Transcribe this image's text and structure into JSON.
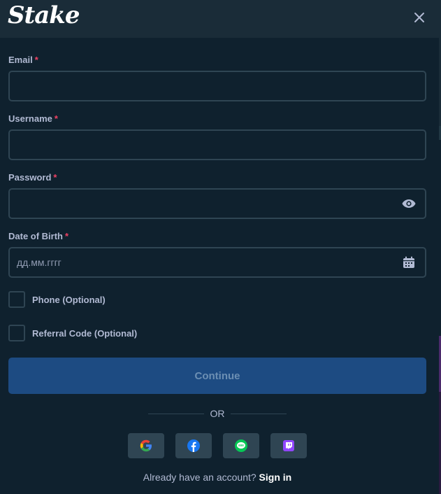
{
  "header": {
    "logo_text": "Stake"
  },
  "form": {
    "email": {
      "label": "Email",
      "required_mark": "*",
      "value": "",
      "placeholder": ""
    },
    "username": {
      "label": "Username",
      "required_mark": "*",
      "value": "",
      "placeholder": ""
    },
    "password": {
      "label": "Password",
      "required_mark": "*",
      "value": "",
      "placeholder": ""
    },
    "dob": {
      "label": "Date of Birth",
      "required_mark": "*",
      "value": "",
      "placeholder": "дд.мм.гггг"
    },
    "phone_checkbox": {
      "label": "Phone (Optional)"
    },
    "referral_checkbox": {
      "label": "Referral Code (Optional)"
    },
    "continue_label": "Continue",
    "or_label": "OR"
  },
  "social": {
    "icons": [
      "google-icon",
      "facebook-icon",
      "line-icon",
      "twitch-icon"
    ],
    "colors": {
      "facebook": "#1877f2",
      "line": "#06c755",
      "twitch": "#9146ff"
    }
  },
  "footer": {
    "prompt": "Already have an account?",
    "signin_label": "Sign in"
  },
  "colors": {
    "background": "#0f212e",
    "header": "#1a2c38",
    "border": "#2f4553",
    "accent": "#1d4b82",
    "required": "#ed4163"
  }
}
